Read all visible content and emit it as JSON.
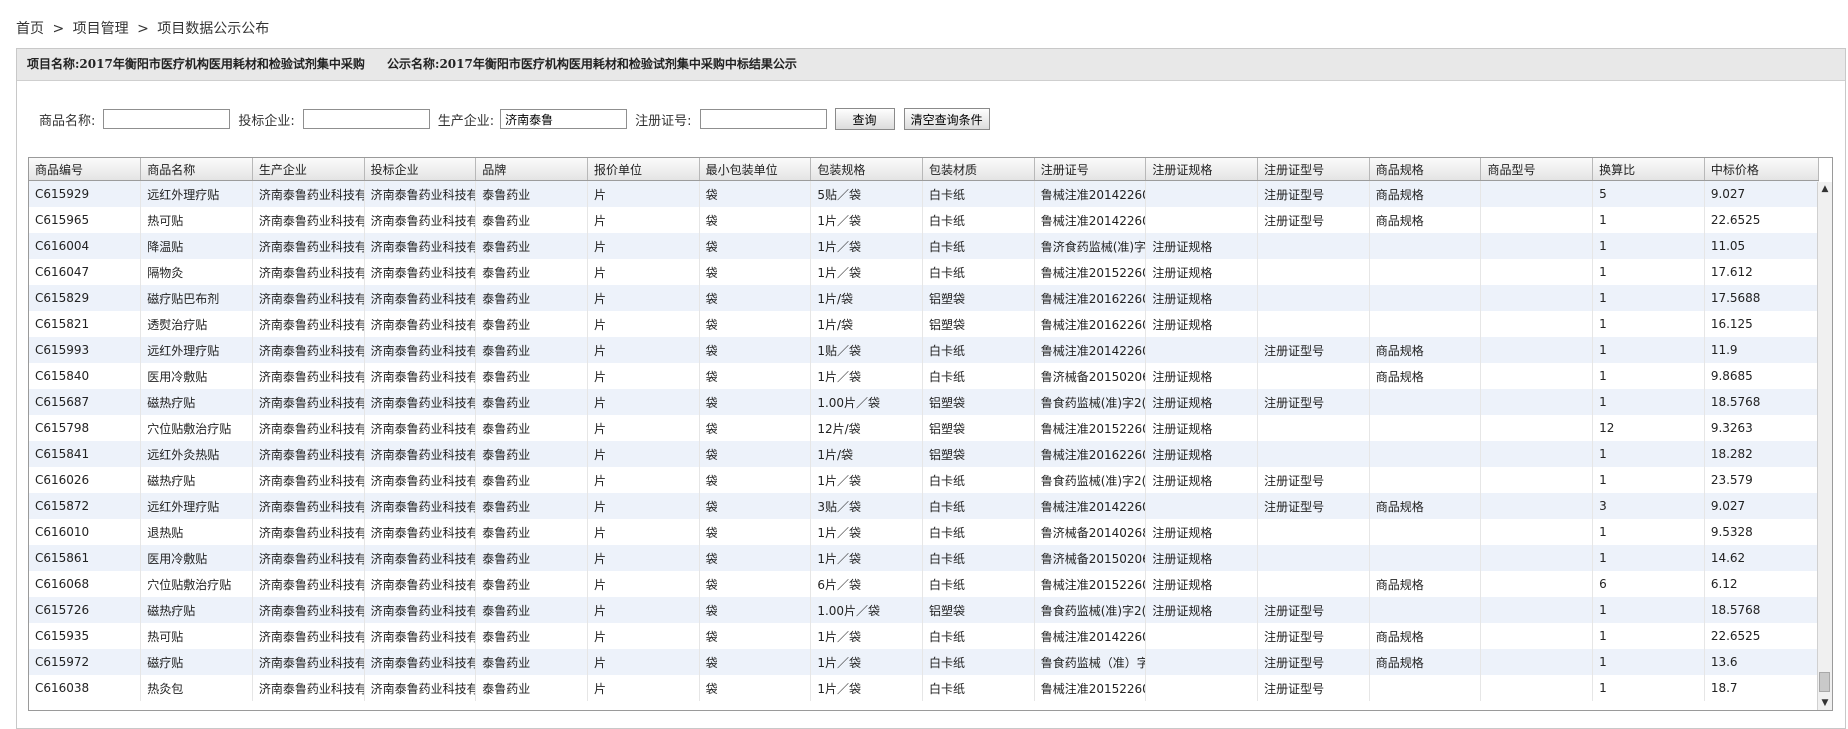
{
  "breadcrumb": {
    "home": "首页",
    "sep": ">",
    "project_mgmt": "项目管理",
    "current": "项目数据公示公布"
  },
  "panel": {
    "project_name": "项目名称:2017年衡阳市医疗机构医用耗材和检验试剂集中采购",
    "notice_name": "公示名称:2017年衡阳市医疗机构医用耗材和检验试剂集中采购中标结果公示"
  },
  "search": {
    "product_name_label": "商品名称:",
    "product_name_value": "",
    "bid_company_label": "投标企业:",
    "bid_company_value": "",
    "maker_label": "生产企业:",
    "maker_value": "济南泰鲁",
    "reg_no_label": "注册证号:",
    "reg_no_value": "",
    "query_button": "查询",
    "clear_button": "清空查询条件"
  },
  "table": {
    "columns": [
      "商品编号",
      "商品名称",
      "生产企业",
      "投标企业",
      "品牌",
      "报价单位",
      "最小包装单位",
      "包装规格",
      "包装材质",
      "注册证号",
      "注册证规格",
      "注册证型号",
      "商品规格",
      "商品型号",
      "换算比",
      "中标价格"
    ],
    "rows": [
      [
        "C615929",
        "远红外理疗贴",
        "济南泰鲁药业科技有",
        "济南泰鲁药业科技有",
        "泰鲁药业",
        "片",
        "袋",
        "5贴／袋",
        "白卡纸",
        "鲁械注准20142260",
        "",
        "注册证型号",
        "商品规格",
        "",
        "5",
        "9.027"
      ],
      [
        "C615965",
        "热可贴",
        "济南泰鲁药业科技有",
        "济南泰鲁药业科技有",
        "泰鲁药业",
        "片",
        "袋",
        "1片／袋",
        "白卡纸",
        "鲁械注准20142260",
        "",
        "注册证型号",
        "商品规格",
        "",
        "1",
        "22.6525"
      ],
      [
        "C616004",
        "降温贴",
        "济南泰鲁药业科技有",
        "济南泰鲁药业科技有",
        "泰鲁药业",
        "片",
        "袋",
        "1片／袋",
        "白卡纸",
        "鲁济食药监械(准)字",
        "注册证规格",
        "",
        "",
        "",
        "1",
        "11.05"
      ],
      [
        "C616047",
        "隔物灸",
        "济南泰鲁药业科技有",
        "济南泰鲁药业科技有",
        "泰鲁药业",
        "片",
        "袋",
        "1片／袋",
        "白卡纸",
        "鲁械注准20152260",
        "注册证规格",
        "",
        "",
        "",
        "1",
        "17.612"
      ],
      [
        "C615829",
        "磁疗贴巴布剂",
        "济南泰鲁药业科技有",
        "济南泰鲁药业科技有",
        "泰鲁药业",
        "片",
        "袋",
        "1片/袋",
        "铝塑袋",
        "鲁械注准20162260",
        "注册证规格",
        "",
        "",
        "",
        "1",
        "17.5688"
      ],
      [
        "C615821",
        "透熨治疗贴",
        "济南泰鲁药业科技有",
        "济南泰鲁药业科技有",
        "泰鲁药业",
        "片",
        "袋",
        "1片/袋",
        "铝塑袋",
        "鲁械注准20162260",
        "注册证规格",
        "",
        "",
        "",
        "1",
        "16.125"
      ],
      [
        "C615993",
        "远红外理疗贴",
        "济南泰鲁药业科技有",
        "济南泰鲁药业科技有",
        "泰鲁药业",
        "片",
        "袋",
        "1贴／袋",
        "白卡纸",
        "鲁械注准20142260",
        "",
        "注册证型号",
        "商品规格",
        "",
        "1",
        "11.9"
      ],
      [
        "C615840",
        "医用冷敷贴",
        "济南泰鲁药业科技有",
        "济南泰鲁药业科技有",
        "泰鲁药业",
        "片",
        "袋",
        "1片／袋",
        "白卡纸",
        "鲁济械备20150206",
        "注册证规格",
        "",
        "商品规格",
        "",
        "1",
        "9.8685"
      ],
      [
        "C615687",
        "磁热疗贴",
        "济南泰鲁药业科技有",
        "济南泰鲁药业科技有",
        "泰鲁药业",
        "片",
        "袋",
        "1.00片／袋",
        "铝塑袋",
        "鲁食药监械(准)字2(",
        "注册证规格",
        "注册证型号",
        "",
        "",
        "1",
        "18.5768"
      ],
      [
        "C615798",
        "穴位贴敷治疗贴",
        "济南泰鲁药业科技有",
        "济南泰鲁药业科技有",
        "泰鲁药业",
        "片",
        "袋",
        "12片/袋",
        "铝塑袋",
        "鲁械注准20152260",
        "注册证规格",
        "",
        "",
        "",
        "12",
        "9.3263"
      ],
      [
        "C615841",
        "远红外灸热贴",
        "济南泰鲁药业科技有",
        "济南泰鲁药业科技有",
        "泰鲁药业",
        "片",
        "袋",
        "1片/袋",
        "铝塑袋",
        "鲁械注准20162260",
        "注册证规格",
        "",
        "",
        "",
        "1",
        "18.282"
      ],
      [
        "C616026",
        "磁热疗贴",
        "济南泰鲁药业科技有",
        "济南泰鲁药业科技有",
        "泰鲁药业",
        "片",
        "袋",
        "1片／袋",
        "白卡纸",
        "鲁食药监械(准)字2(",
        "注册证规格",
        "注册证型号",
        "",
        "",
        "1",
        "23.579"
      ],
      [
        "C615872",
        "远红外理疗贴",
        "济南泰鲁药业科技有",
        "济南泰鲁药业科技有",
        "泰鲁药业",
        "片",
        "袋",
        "3贴／袋",
        "白卡纸",
        "鲁械注准20142260",
        "",
        "注册证型号",
        "商品规格",
        "",
        "3",
        "9.027"
      ],
      [
        "C616010",
        "退热贴",
        "济南泰鲁药业科技有",
        "济南泰鲁药业科技有",
        "泰鲁药业",
        "片",
        "袋",
        "1片／袋",
        "白卡纸",
        "鲁济械备20140268",
        "注册证规格",
        "",
        "",
        "",
        "1",
        "9.5328"
      ],
      [
        "C615861",
        "医用冷敷贴",
        "济南泰鲁药业科技有",
        "济南泰鲁药业科技有",
        "泰鲁药业",
        "片",
        "袋",
        "1片／袋",
        "白卡纸",
        "鲁济械备20150206",
        "注册证规格",
        "",
        "",
        "",
        "1",
        "14.62"
      ],
      [
        "C616068",
        "穴位贴敷治疗贴",
        "济南泰鲁药业科技有",
        "济南泰鲁药业科技有",
        "泰鲁药业",
        "片",
        "袋",
        "6片／袋",
        "白卡纸",
        "鲁械注准20152260",
        "注册证规格",
        "",
        "商品规格",
        "",
        "6",
        "6.12"
      ],
      [
        "C615726",
        "磁热疗贴",
        "济南泰鲁药业科技有",
        "济南泰鲁药业科技有",
        "泰鲁药业",
        "片",
        "袋",
        "1.00片／袋",
        "铝塑袋",
        "鲁食药监械(准)字2(",
        "注册证规格",
        "注册证型号",
        "",
        "",
        "1",
        "18.5768"
      ],
      [
        "C615935",
        "热可贴",
        "济南泰鲁药业科技有",
        "济南泰鲁药业科技有",
        "泰鲁药业",
        "片",
        "袋",
        "1片／袋",
        "白卡纸",
        "鲁械注准20142260",
        "",
        "注册证型号",
        "商品规格",
        "",
        "1",
        "22.6525"
      ],
      [
        "C615972",
        "磁疗贴",
        "济南泰鲁药业科技有",
        "济南泰鲁药业科技有",
        "泰鲁药业",
        "片",
        "袋",
        "1片／袋",
        "白卡纸",
        "鲁食药监械（准）字",
        "",
        "注册证型号",
        "商品规格",
        "",
        "1",
        "13.6"
      ],
      [
        "C616038",
        "热灸包",
        "济南泰鲁药业科技有",
        "济南泰鲁药业科技有",
        "泰鲁药业",
        "片",
        "袋",
        "1片／袋",
        "白卡纸",
        "鲁械注准20152260",
        "",
        "注册证型号",
        "",
        "",
        "1",
        "18.7"
      ]
    ]
  },
  "colors": {
    "row_alt": "#edf2fa",
    "header_bg": "#e8e8e8"
  },
  "icons": {
    "scroll_up": "triangle-up",
    "scroll_down": "triangle-down"
  }
}
